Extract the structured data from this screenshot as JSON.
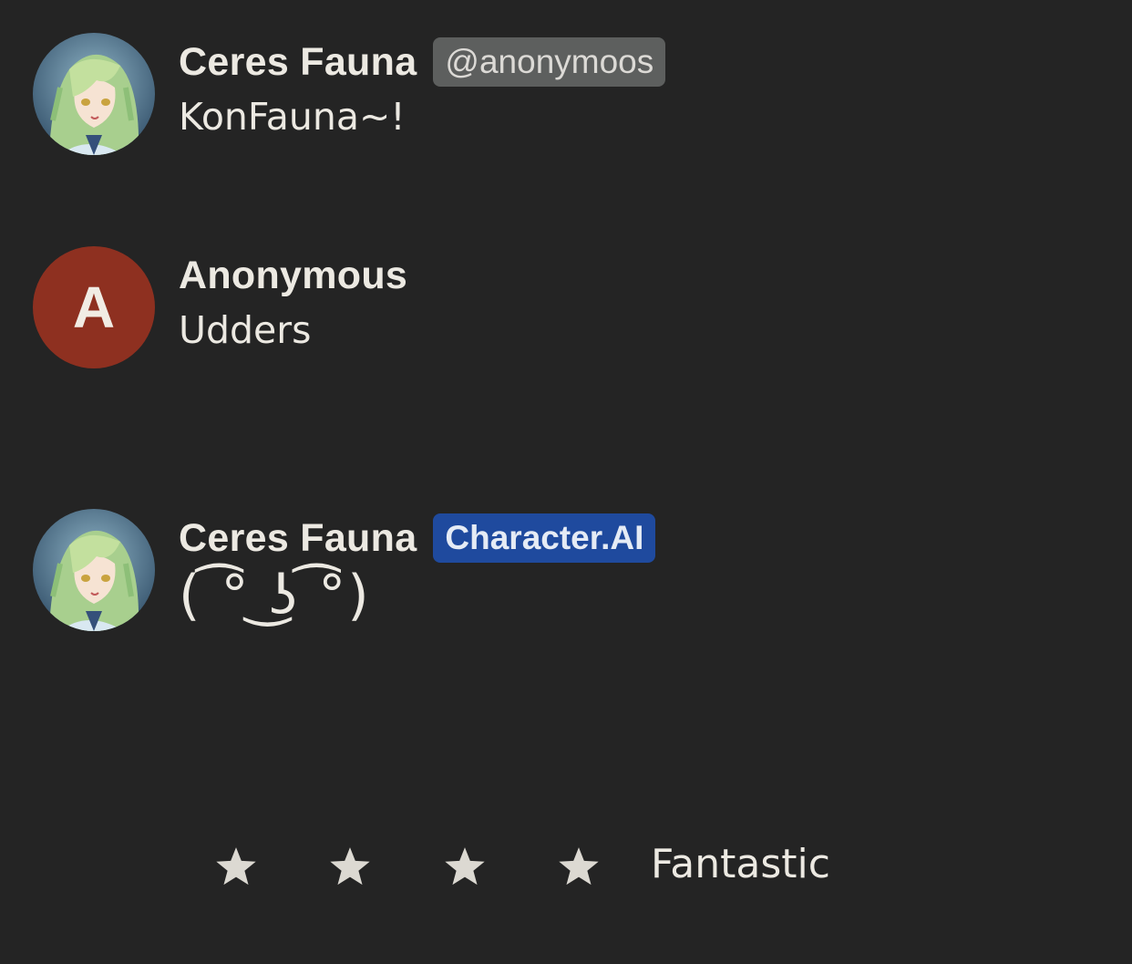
{
  "messages": [
    {
      "sender": "Ceres Fauna",
      "badge": "@anonymoos",
      "badge_type": "user",
      "text": "KonFauna~!",
      "avatar": "character-portrait-image"
    },
    {
      "sender": "Anonymous",
      "avatar_letter": "A",
      "text": "Udders",
      "avatar_color": "#8e3020"
    },
    {
      "sender": "Ceres Fauna",
      "badge": "Character.AI",
      "badge_type": "ai",
      "text": "( ͡° ͜ʖ ͡°)",
      "avatar": "character-portrait-image"
    }
  ],
  "rating": {
    "stars_visible": 4,
    "star_icon": "star-icon",
    "label": "Fantastic"
  },
  "colors": {
    "background": "#242424",
    "text": "#ece9e2",
    "user_badge": "#5d5f5e",
    "ai_badge": "#1f4a9e",
    "anonymous_avatar": "#8e3020",
    "star": "#dcd9d2"
  }
}
